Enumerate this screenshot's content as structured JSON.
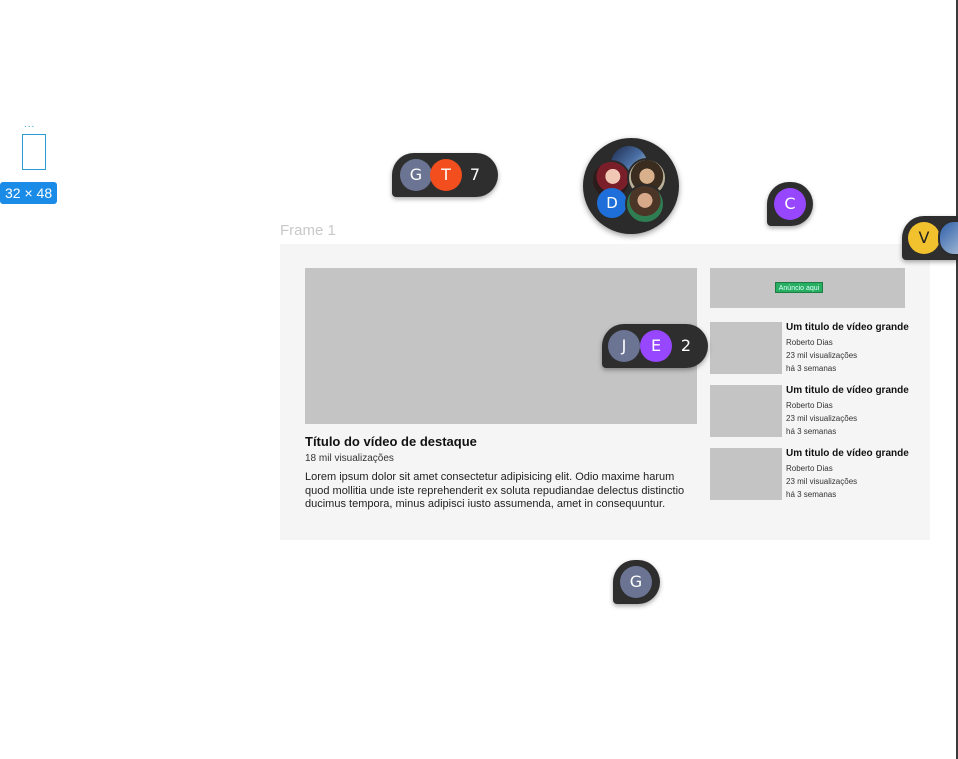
{
  "selection": {
    "dots": "...",
    "size_label": "32 × 48"
  },
  "frame": {
    "label": "Frame 1"
  },
  "featured": {
    "title": "Título do vídeo de destaque",
    "views": "18 mil visualizações",
    "description": "Lorem ipsum dolor sit amet consectetur adipisicing elit. Odio maxime harum quod mollitia unde iste reprehenderit ex soluta repudiandae delectus distinctio ducimus tempora, minus adipisci iusto assumenda, amet in consequuntur."
  },
  "sidebar_top": {
    "tag_text": "Anúncio aqui"
  },
  "side_videos": [
    {
      "title": "Um titulo de vídeo grande",
      "channel": "Roberto Dias",
      "views": "23  mil visualizações",
      "age": "há 3 semanas"
    },
    {
      "title": "Um titulo de vídeo grande",
      "channel": "Roberto Dias",
      "views": "23  mil visualizações",
      "age": "há 3 semanas"
    },
    {
      "title": "Um titulo de vídeo grande",
      "channel": "Roberto Dias",
      "views": "23  mil visualizações",
      "age": "há 3 semanas"
    }
  ],
  "collaborators": {
    "group_a": {
      "avatars": [
        "G",
        "T"
      ],
      "count": "7"
    },
    "group_b": {
      "avatars": [
        "J",
        "E"
      ],
      "count": "2"
    },
    "cluster": {
      "initial": "D"
    },
    "single_c": "C",
    "single_v": "V",
    "single_g": "G"
  },
  "colors": {
    "selection_blue": "#1a8ce8",
    "avatar_slate": "#6b7593",
    "avatar_orange": "#f24e1e",
    "avatar_purple": "#9747ff",
    "avatar_yellow": "#f2c12e",
    "avatar_blue": "#1e6fd9",
    "tag_green": "#27ae60"
  }
}
